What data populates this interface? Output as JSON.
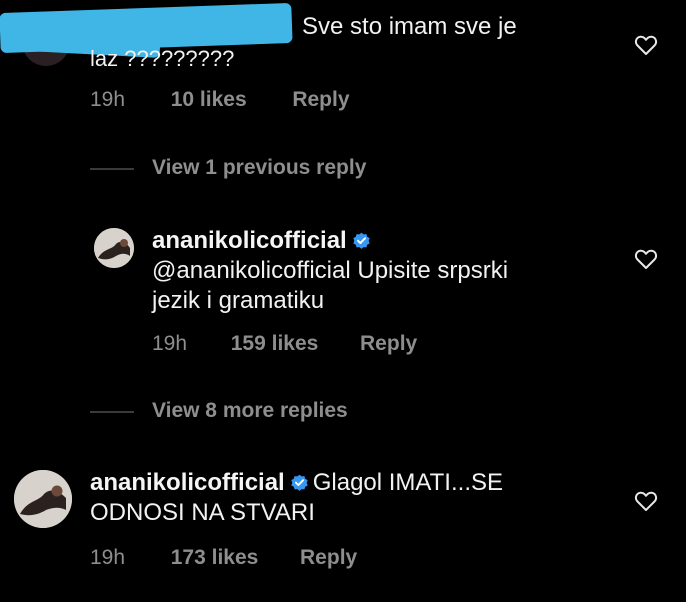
{
  "comment_top": {
    "text_line1": "Sve sto imam sve je",
    "text_line2": "laz ?????????",
    "time": "19h",
    "likes": "10 likes",
    "reply_label": "Reply"
  },
  "view_previous": {
    "label": "View 1 previous reply"
  },
  "reply_1": {
    "username": "ananikolicofficial",
    "text_line1": "@ananikolicofficial Upisite srpsrki",
    "text_line2": "jezik i gramatiku",
    "time": "19h",
    "likes": "159 likes",
    "reply_label": "Reply"
  },
  "view_more": {
    "label": "View 8 more replies"
  },
  "comment_main": {
    "username": "ananikolicofficial",
    "text_part1": "Glagol IMATI...SE",
    "text_line2": "ODNOSI NA STVARI",
    "time": "19h",
    "likes": "173 likes",
    "reply_label": "Reply"
  },
  "icons": {
    "like": "heart-icon",
    "verified": "verified-badge-icon",
    "accent": "#3897f0",
    "redaction_color": "#3fb6e6"
  }
}
